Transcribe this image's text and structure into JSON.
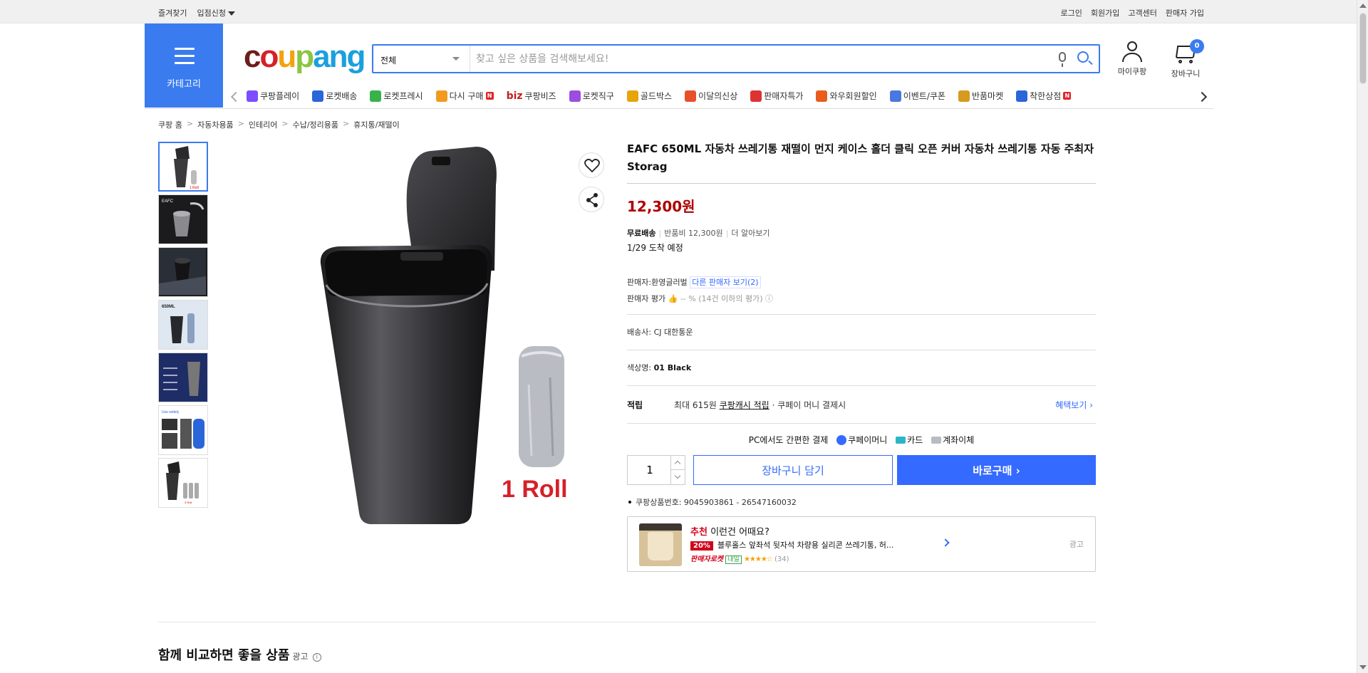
{
  "topbar": {
    "favorites": "즐겨찾기",
    "store_apply": "입점신청",
    "login": "로그인",
    "signup": "회원가입",
    "customer_center": "고객센터",
    "seller_signup": "판매자 가입"
  },
  "header": {
    "category_label": "카테고리",
    "logo_parts": [
      "c",
      "o",
      "u",
      "p",
      "ang"
    ],
    "search_scope": "전체",
    "search_placeholder": "찾고 싶은 상품을 검색해보세요!",
    "my_coupang": "마이쿠팡",
    "cart_label": "장바구니",
    "cart_count": "0"
  },
  "nav": {
    "items": [
      {
        "label": "쿠팡플레이",
        "icon": "play-icon",
        "color": "#7b4dff"
      },
      {
        "label": "로켓배송",
        "icon": "rocket-icon",
        "color": "#2a66d9"
      },
      {
        "label": "로켓프레시",
        "icon": "rocket-fresh-icon",
        "color": "#38b24a"
      },
      {
        "label": "다시 구매",
        "icon": "rebuy-icon",
        "color": "#f29a1f",
        "badge": "N"
      },
      {
        "label": "쿠팡비즈",
        "prefix": "biz",
        "icon": "biz-icon",
        "color": "#c02020"
      },
      {
        "label": "로켓직구",
        "icon": "rocket-global-icon",
        "color": "#9a4de0"
      },
      {
        "label": "골드박스",
        "icon": "gold-box-icon",
        "color": "#e6a50b"
      },
      {
        "label": "이달의신상",
        "icon": "new-icon",
        "color": "#e8502c"
      },
      {
        "label": "판매자특가",
        "icon": "seller-deal-icon",
        "color": "#d33"
      },
      {
        "label": "와우회원할인",
        "icon": "wow-icon",
        "color": "#e85d1b"
      },
      {
        "label": "이벤트/쿠폰",
        "icon": "coupon-icon",
        "color": "#4a78e0"
      },
      {
        "label": "반품마켓",
        "icon": "return-market-icon",
        "color": "#d69a1e"
      },
      {
        "label": "착한상점",
        "icon": "good-store-icon",
        "color": "#2a66d9",
        "badge": "N"
      }
    ]
  },
  "breadcrumb": [
    "쿠팡 홈",
    "자동차용품",
    "인테리어",
    "수납/정리용품",
    "휴지통/재떨이"
  ],
  "product": {
    "title": "EAFC 650ML 자동차 쓰레기통 재떨이 먼지 케이스 홀더 클릭 오픈 커버 자동차 쓰레기통 자동 주최자 Storag",
    "price": "12,300원",
    "shipping_free": "무료배송",
    "return_fee": "반품비 12,300원",
    "more_info": "더 알아보기",
    "arrival": "1/29 도착 예정",
    "seller_label": "판매자:",
    "seller_name": "환영글러벌",
    "other_sellers": "다른 판매자 보기(2)",
    "seller_rating_label": "판매자 평가",
    "seller_rating_value": "-- % (14건 이하의 평가)",
    "carrier_label": "배송사:",
    "carrier": "CJ 대한통운",
    "color_label": "색상명:",
    "color_value": "01 Black",
    "points_label": "적립",
    "points_text_pre": "최대 615원",
    "points_link": "쿠팡캐시 적립",
    "points_text_post": "· 쿠페이 머니 결제시",
    "benefits_link": "혜택보기",
    "pay_title": "PC에서도 간편한 결제",
    "pay_methods": [
      "쿠페이머니",
      "카드",
      "계좌이체"
    ],
    "quantity": "1",
    "add_cart": "장바구니 담기",
    "buy_now": "바로구매",
    "product_no": "쿠팡상품번호: 9045903861 - 26547160032",
    "image_caption": "1 Roll"
  },
  "recommendation": {
    "tag": "추천",
    "headline": "이런건 어때요?",
    "discount": "20%",
    "name": "블루홀스 앞좌석 뒷자석 차량용 실리콘 쓰레기통, 허...",
    "rocket_label": "판매자로켓",
    "tomorrow": "내일",
    "stars": "★★★★☆",
    "review_count": "(34)",
    "ad_label": "광고"
  },
  "section": {
    "title": "함께 비교하면 좋을 상품",
    "ad": "광고"
  },
  "colors": {
    "accent": "#346aff",
    "category_bg": "#3a7bf0",
    "price": "#ae0000"
  }
}
